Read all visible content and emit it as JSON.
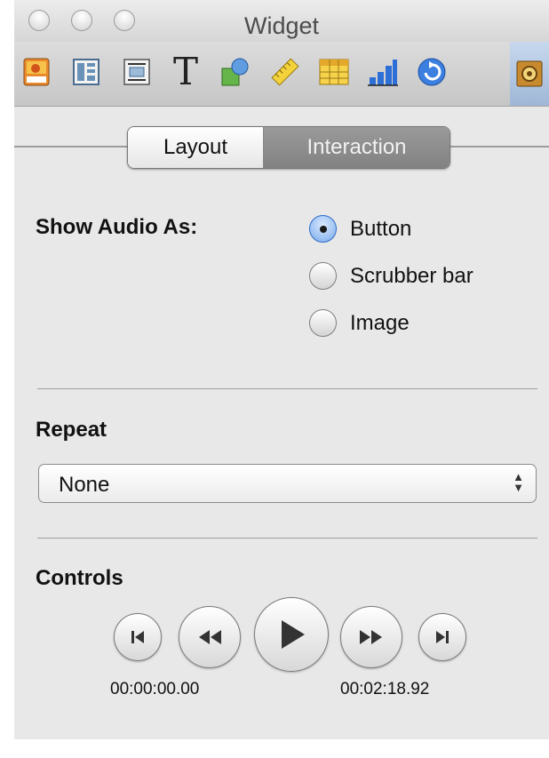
{
  "window": {
    "title": "Widget"
  },
  "toolbar": {
    "items": [
      {
        "name": "media",
        "icon": "image-icon"
      },
      {
        "name": "layout",
        "icon": "layout-icon"
      },
      {
        "name": "wrap",
        "icon": "wrap-icon"
      },
      {
        "name": "text",
        "icon": "text-icon",
        "glyph": "T"
      },
      {
        "name": "graphic",
        "icon": "shapes-icon"
      },
      {
        "name": "metrics",
        "icon": "ruler-icon"
      },
      {
        "name": "table",
        "icon": "table-icon"
      },
      {
        "name": "chart",
        "icon": "chart-icon"
      },
      {
        "name": "link",
        "icon": "link-icon"
      },
      {
        "name": "widget",
        "icon": "widget-gear-icon",
        "active": true
      }
    ]
  },
  "tabs": {
    "layout": "Layout",
    "interaction": "Interaction",
    "selected": "Interaction"
  },
  "show_audio": {
    "label": "Show Audio As:",
    "options": [
      "Button",
      "Scrubber bar",
      "Image"
    ],
    "selected": "Button"
  },
  "repeat": {
    "label": "Repeat",
    "value": "None"
  },
  "controls": {
    "label": "Controls",
    "start_time": "00:00:00.00",
    "end_time": "00:02:18.92"
  },
  "colors": {
    "accent": "#3b78d8",
    "panel": "#e8e8e8"
  }
}
